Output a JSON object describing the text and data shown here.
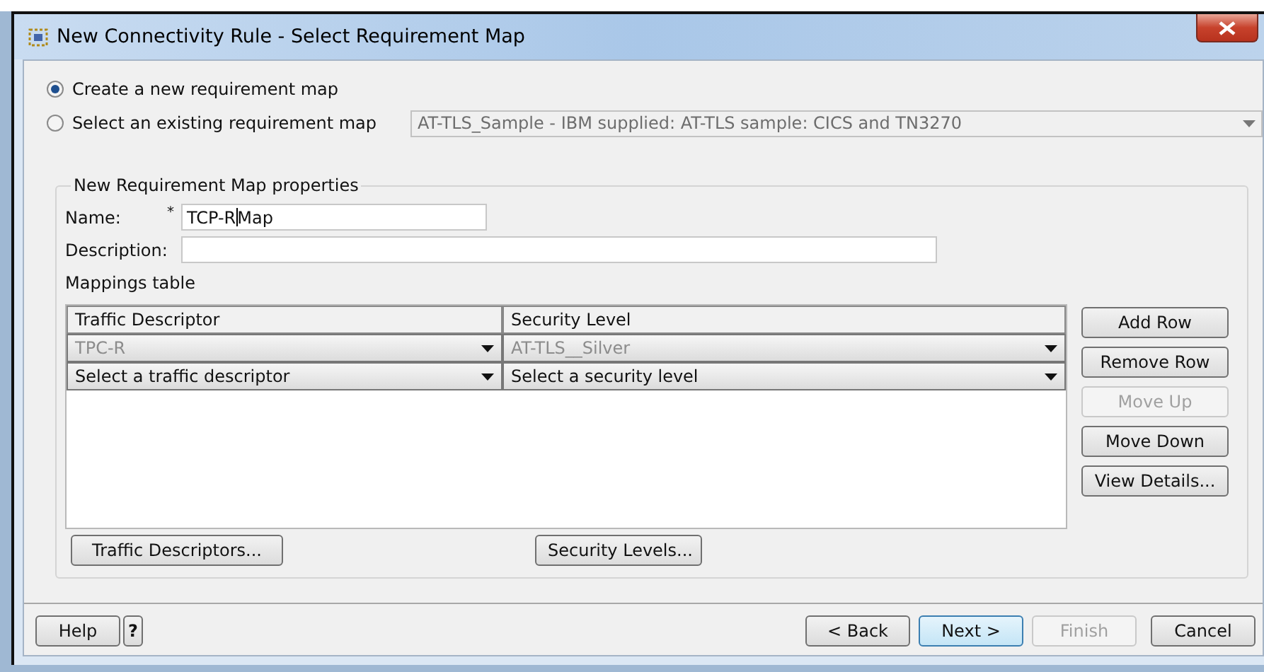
{
  "window": {
    "title": "New Connectivity Rule - Select Requirement Map"
  },
  "map_source": [
    {
      "label": "Create a new requirement map",
      "selected": true
    },
    {
      "label": "Select an existing requirement map",
      "selected": false
    }
  ],
  "existing_map": {
    "value": "AT-TLS_Sample - IBM supplied: AT-TLS sample: CICS and TN3270",
    "disabled": true
  },
  "properties": {
    "title": "New Requirement Map properties",
    "name": {
      "label": "Name:",
      "required_mark": "*",
      "value": "TCP-RMap"
    },
    "description": {
      "label": "Description:"
    },
    "mappings": {
      "label": "Mappings table",
      "columns": [
        "Traffic Descriptor",
        "Security Level"
      ],
      "rows": [
        {
          "cells": [
            "TPC-R",
            "AT-TLS__Silver"
          ],
          "disabled": true
        },
        {
          "cells": [
            "Select a traffic descriptor",
            "Select a security level"
          ],
          "disabled": false
        }
      ]
    },
    "side_buttons": [
      {
        "label": "Add Row",
        "disabled": false
      },
      {
        "label": "Remove Row",
        "disabled": false
      },
      {
        "label": "Move Up",
        "disabled": true
      },
      {
        "label": "Move Down",
        "disabled": false
      },
      {
        "label": "View Details...",
        "disabled": false
      }
    ],
    "bottom_buttons": [
      "Traffic Descriptors...",
      "Security Levels..."
    ]
  },
  "footer": {
    "help": "Help",
    "help_icon": "?",
    "buttons": [
      {
        "label": "< Back",
        "disabled": false,
        "default": false
      },
      {
        "label": "Next >",
        "disabled": false,
        "default": true
      },
      {
        "label": "Finish",
        "disabled": true,
        "default": false
      },
      {
        "label": "Cancel",
        "disabled": false,
        "default": false
      }
    ]
  }
}
